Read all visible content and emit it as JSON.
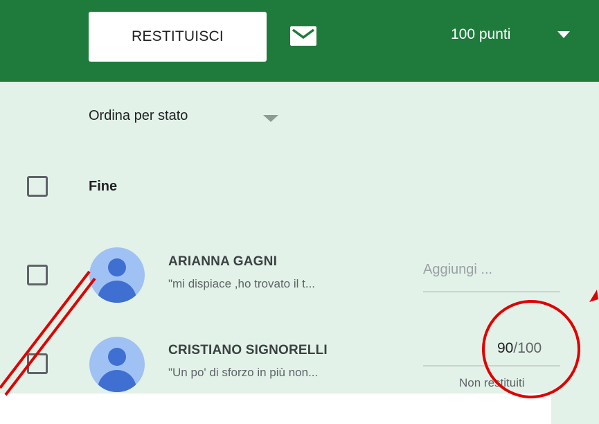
{
  "toolbar": {
    "return_label": "RESTITUISCI",
    "points_label": "100 punti",
    "mail_icon": "mail-icon",
    "caret_icon": "caret-down-icon"
  },
  "list": {
    "sort_label": "Ordina per stato",
    "group_label": "Fine",
    "students": [
      {
        "name": "ARIANNA GAGNI",
        "comment": "\"mi dispiace ,ho trovato il t...",
        "grade_placeholder": "Aggiungi ..."
      },
      {
        "name": "CRISTIANO SIGNORELLI",
        "comment": "\"Un po' di sforzo in più non...",
        "grade": "90",
        "grade_denominator": "/100",
        "status": "Non restituiti"
      }
    ]
  },
  "colors": {
    "header": "#1e7b3b",
    "panel": "#e2f2e8",
    "avatar": "#9fc1f4",
    "annotation": "#e00000"
  }
}
